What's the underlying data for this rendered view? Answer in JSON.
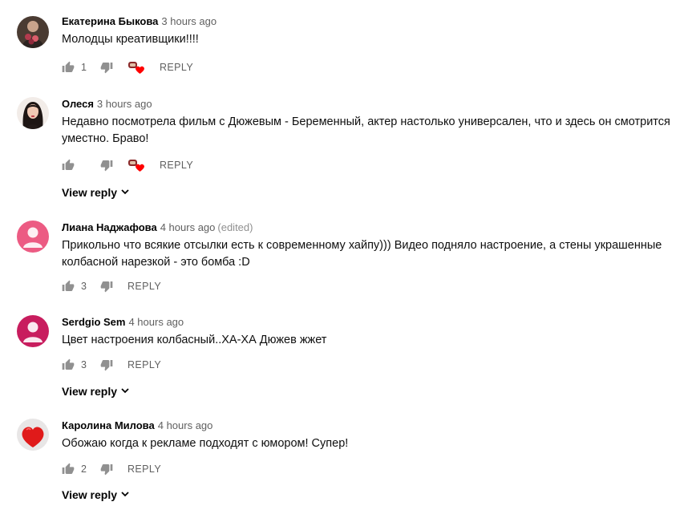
{
  "comments": [
    {
      "author": "Екатерина Быкова",
      "time": "3 hours ago",
      "edited": "",
      "text": "Молодцы креативщики!!!!",
      "likes": "1",
      "has_creator_heart": true,
      "reply_label": "REPLY",
      "view_reply_label": ""
    },
    {
      "author": "Олеся",
      "time": "3 hours ago",
      "edited": "",
      "text": "Недавно посмотрела фильм с Дюжевым - Беременный, актер настолько универсален, что и здесь он смотрится уместно. Браво!",
      "likes": "",
      "has_creator_heart": true,
      "reply_label": "REPLY",
      "view_reply_label": "View reply"
    },
    {
      "author": "Лиана Наджафова",
      "time": "4 hours ago",
      "edited": "(edited)",
      "text": "Прикольно что всякие отсылки есть к современному хайпу))) Видео подняло настроение, а стены украшенные колбасной нарезкой - это бомба :D",
      "likes": "3",
      "has_creator_heart": false,
      "reply_label": "REPLY",
      "view_reply_label": ""
    },
    {
      "author": "Serdgio Sem",
      "time": "4 hours ago",
      "edited": "",
      "text": "Цвет настроения колбасный..ХА-ХА Дюжев жжет",
      "likes": "3",
      "has_creator_heart": false,
      "reply_label": "REPLY",
      "view_reply_label": "View reply"
    },
    {
      "author": "Каролина Милова",
      "time": "4 hours ago",
      "edited": "",
      "text": "Обожаю когда к рекламе подходят с юмором! Супер!",
      "likes": "2",
      "has_creator_heart": false,
      "reply_label": "REPLY",
      "view_reply_label": "View reply"
    }
  ],
  "icons": {
    "like": "thumbs-up-icon",
    "dislike": "thumbs-down-icon",
    "creator_heart": "creator-heart-icon",
    "expand": "chevron-down-icon"
  },
  "colors": {
    "author": "#030303",
    "meta": "#606060",
    "edited": "#909090",
    "heart": "#ff0000",
    "icon": "#909090"
  }
}
